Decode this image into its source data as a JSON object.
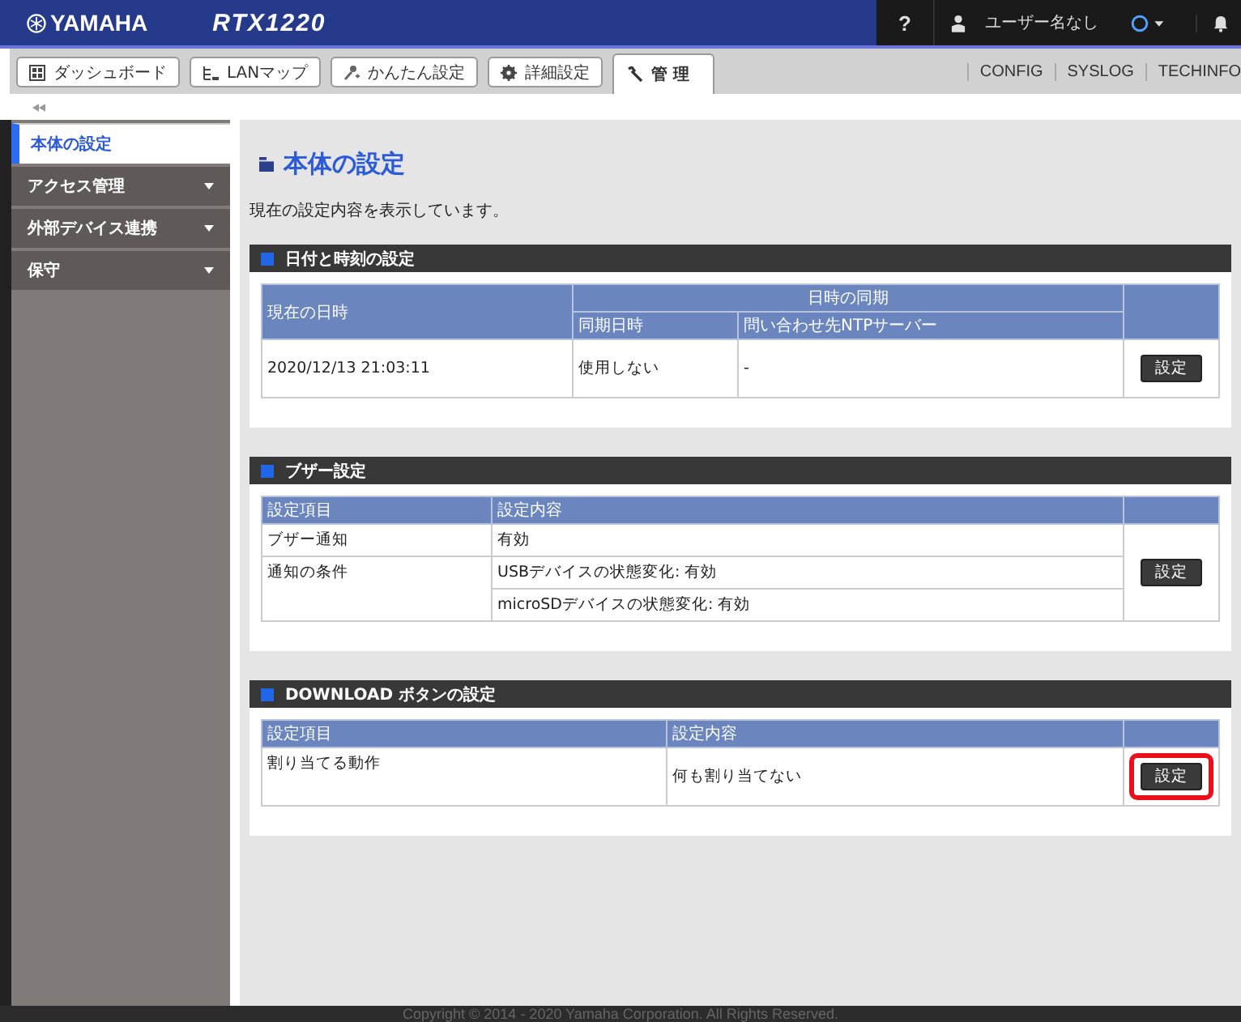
{
  "header": {
    "brand": "YAMAHA",
    "model": "RTX1220",
    "help": "?",
    "user": "ユーザー名なし"
  },
  "tabs": [
    {
      "label": "ダッシュボード",
      "selected": false
    },
    {
      "label": "LANマップ",
      "selected": false
    },
    {
      "label": "かんたん設定",
      "selected": false
    },
    {
      "label": "詳細設定",
      "selected": false
    },
    {
      "label": "管 理",
      "selected": true
    }
  ],
  "top_links": [
    "CONFIG",
    "SYSLOG",
    "TECHINFO"
  ],
  "sidebar": {
    "items": [
      {
        "label": "本体の設定",
        "selected": true,
        "has_submenu": false
      },
      {
        "label": "アクセス管理",
        "selected": false,
        "has_submenu": true
      },
      {
        "label": "外部デバイス連携",
        "selected": false,
        "has_submenu": true
      },
      {
        "label": "保守",
        "selected": false,
        "has_submenu": true
      }
    ]
  },
  "page": {
    "title": "本体の設定",
    "description": "現在の設定内容を表示しています。"
  },
  "sections": [
    {
      "kind": "sync",
      "title": "日付と時刻の設定",
      "first_column": "現在の日時",
      "group": "日時の同期",
      "sub_columns": [
        "同期日時",
        "問い合わせ先NTPサーバー"
      ],
      "row": [
        "2020/12/13 21:03:11",
        "使用しない",
        "-"
      ],
      "button": {
        "label": "設定",
        "highlighted": false
      }
    },
    {
      "kind": "items",
      "title": "ブザー設定",
      "columns": [
        "設定項目",
        "設定内容"
      ],
      "rows": [
        {
          "item": "ブザー通知",
          "values": [
            "有効"
          ]
        },
        {
          "item": "通知の条件",
          "values": [
            "USBデバイスの状態変化: 有効",
            "microSDデバイスの状態変化: 有効"
          ]
        }
      ],
      "button": {
        "label": "設定",
        "highlighted": false
      }
    },
    {
      "kind": "items",
      "title": "DOWNLOAD ボタンの設定",
      "columns": [
        "設定項目",
        "設定内容"
      ],
      "rows": [
        {
          "item": "割り当てる動作",
          "values": [
            "何も割り当てない"
          ]
        }
      ],
      "button": {
        "label": "設定",
        "highlighted": true
      }
    }
  ],
  "footer": "Copyright © 2014 - 2020 Yamaha Corporation. All Rights Reserved."
}
